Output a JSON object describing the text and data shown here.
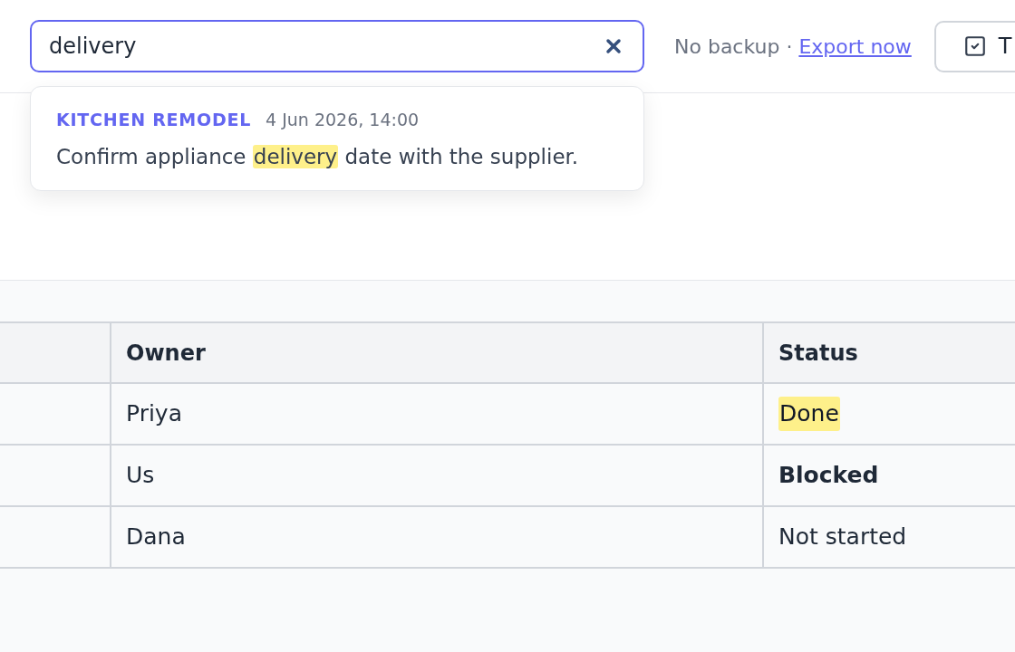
{
  "search": {
    "value": "delivery",
    "results": [
      {
        "project": "KITCHEN REMODEL",
        "timestamp": "4 Jun 2026, 14:00",
        "snippet": [
          {
            "text": "Confirm appliance ",
            "highlighted": false
          },
          {
            "text": "delivery",
            "highlighted": true
          },
          {
            "text": " date with the supplier.",
            "highlighted": false
          }
        ]
      }
    ]
  },
  "backup": {
    "status": "No backup · ",
    "link": "Export now"
  },
  "toolbar_button": {
    "label": "T"
  },
  "table": {
    "columns": [
      "Owner",
      "Status"
    ],
    "rows": [
      {
        "owner": "Priya",
        "status": {
          "text": "Done",
          "kind": "highlighted"
        }
      },
      {
        "owner": "Us",
        "status": {
          "text": "Blocked",
          "kind": "bold"
        }
      },
      {
        "owner": "Dana",
        "status": {
          "text": "Not started",
          "kind": "plain"
        }
      }
    ]
  }
}
